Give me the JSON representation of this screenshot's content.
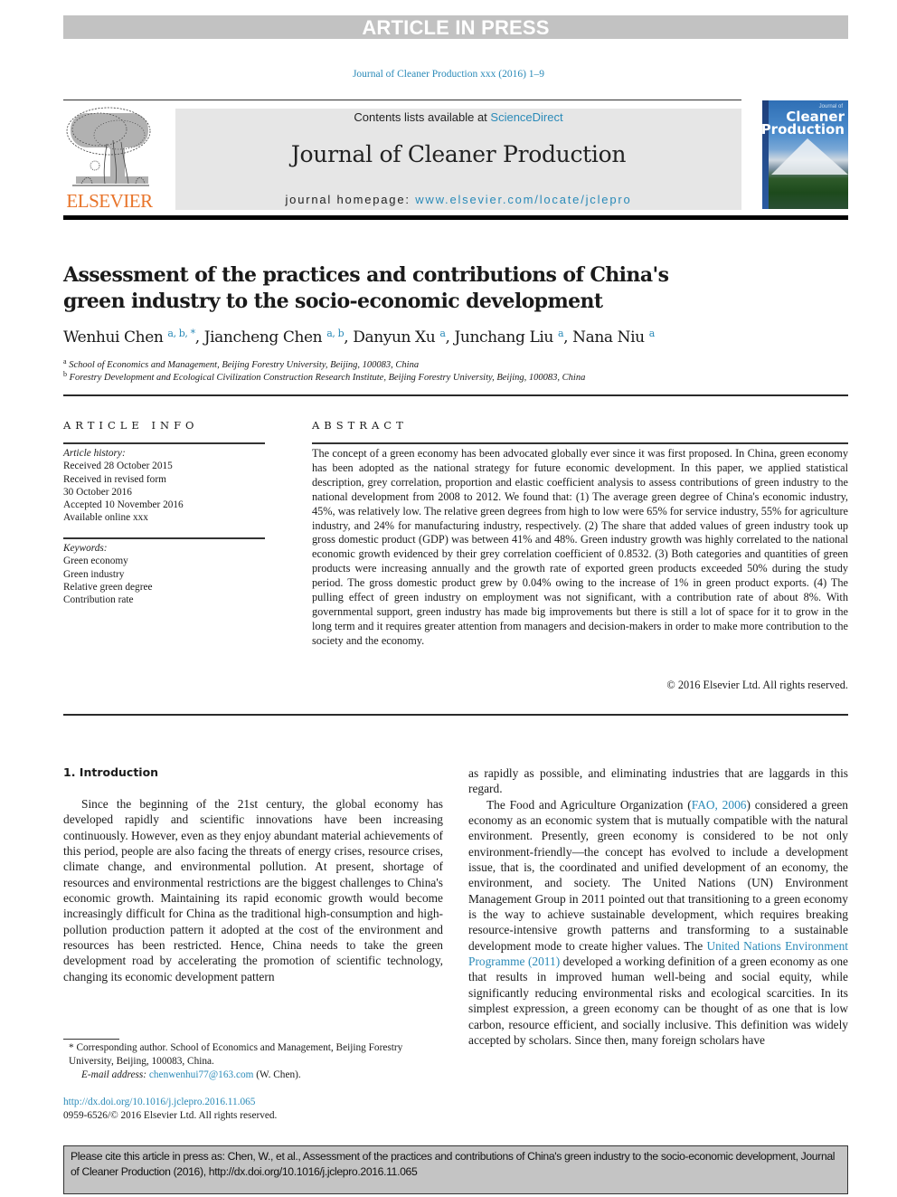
{
  "banner": {
    "label": "ARTICLE IN PRESS"
  },
  "journal_ref": "Journal of Cleaner Production xxx (2016) 1–9",
  "masthead": {
    "publisher_logo_text": "ELSEVIER",
    "contents_prefix": "Contents lists available at ",
    "contents_link": "ScienceDirect",
    "journal_title": "Journal of Cleaner Production",
    "homepage_prefix": "journal homepage: ",
    "homepage_link": "www.elsevier.com/locate/jclepro",
    "cover": {
      "small_title": "Journal of",
      "title_line1": "Cleaner",
      "title_line2": "Production"
    }
  },
  "article": {
    "title": "Assessment of the practices and contributions of China's green industry to the socio-economic development",
    "authors": [
      {
        "name": "Wenhui Chen",
        "affil": "a, b, *",
        "sep": ", "
      },
      {
        "name": "Jiancheng Chen",
        "affil": "a, b",
        "sep": ", "
      },
      {
        "name": "Danyun Xu",
        "affil": "a",
        "sep": ", "
      },
      {
        "name": "Junchang Liu",
        "affil": "a",
        "sep": ", "
      },
      {
        "name": "Nana Niu",
        "affil": "a",
        "sep": ""
      }
    ],
    "affiliations": [
      {
        "key": "a",
        "text": "School of Economics and Management, Beijing Forestry University, Beijing, 100083, China"
      },
      {
        "key": "b",
        "text": "Forestry Development and Ecological Civilization Construction Research Institute, Beijing Forestry University, Beijing, 100083, China"
      }
    ]
  },
  "article_info": {
    "heading": "ARTICLE INFO",
    "history_label": "Article history:",
    "history": [
      "Received 28 October 2015",
      "Received in revised form",
      "30 October 2016",
      "Accepted 10 November 2016",
      "Available online xxx"
    ],
    "keywords_label": "Keywords:",
    "keywords": [
      "Green economy",
      "Green industry",
      "Relative green degree",
      "Contribution rate"
    ]
  },
  "abstract": {
    "heading": "ABSTRACT",
    "text": "The concept of a green economy has been advocated globally ever since it was first proposed. In China, green economy has been adopted as the national strategy for future economic development. In this paper, we applied statistical description, grey correlation, proportion and elastic coefficient analysis to assess contributions of green industry to the national development from 2008 to 2012. We found that: (1) The average green degree of China's economic industry, 45%, was relatively low. The relative green degrees from high to low were 65% for service industry, 55% for agriculture industry, and 24% for manufacturing industry, respectively. (2) The share that added values of green industry took up gross domestic product (GDP) was between 41% and 48%. Green industry growth was highly correlated to the national economic growth evidenced by their grey correlation coefficient of 0.8532. (3) Both categories and quantities of green products were increasing annually and the growth rate of exported green products exceeded 50% during the study period. The gross domestic product grew by 0.04% owing to the increase of 1% in green product exports. (4) The pulling effect of green industry on employment was not significant, with a contribution rate of about 8%. With governmental support, green industry has made big improvements but there is still a lot of space for it to grow in the long term and it requires greater attention from managers and decision-makers in order to make more contribution to the society and the economy.",
    "copyright": "© 2016 Elsevier Ltd. All rights reserved."
  },
  "body": {
    "section_heading": "1.  Introduction",
    "left_paragraph": "Since the beginning of the 21st century, the global economy has developed rapidly and scientific innovations have been increasing continuously. However, even as they enjoy abundant material achievements of this period, people are also facing the threats of energy crises, resource crises, climate change, and environmental pollution. At present, shortage of resources and environmental restrictions are the biggest challenges to China's economic growth. Maintaining its rapid economic growth would become increasingly difficult for China as the traditional high-consumption and high-pollution production pattern it adopted at the cost of the environment and resources has been restricted. Hence, China needs to take the green development road by accelerating the promotion of scientific technology, changing its economic development pattern",
    "right_continuation": "as rapidly as possible, and eliminating industries that are laggards in this regard.",
    "right_p2_a": "The Food and Agriculture Organization (",
    "right_p2_link1": "FAO, 2006",
    "right_p2_b": ") considered a green economy as an economic system that is mutually compatible with the natural environment. Presently, green economy is considered to be not only environment-friendly—the concept has evolved to include a development issue, that is, the coordinated and unified development of an economy, the environment, and society. The United Nations (UN) Environment Management Group in 2011 pointed out that transitioning to a green economy is the way to achieve sustainable development, which requires breaking resource-intensive growth patterns and transforming to a sustainable development mode to create higher values. The ",
    "right_p2_link2": "United Nations Environment Programme (2011)",
    "right_p2_c": " developed a working definition of a green economy as one that results in improved human well-being and social equity, while significantly reducing environmental risks and ecological scarcities. In its simplest expression, a green economy can be thought of as one that is low carbon, resource efficient, and socially inclusive. This definition was widely accepted by scholars. Since then, many foreign scholars have"
  },
  "footnote": {
    "star": "*",
    "corresponding": "Corresponding author. School of Economics and Management, Beijing Forestry University, Beijing, 100083, China.",
    "email_label": "E-mail address: ",
    "email": "chenwenhui77@163.com",
    "email_suffix": " (W. Chen).",
    "doi": "http://dx.doi.org/10.1016/j.jclepro.2016.11.065",
    "issn_line": "0959-6526/© 2016 Elsevier Ltd. All rights reserved."
  },
  "cite_box": {
    "text": "Please cite this article in press as: Chen, W., et al., Assessment of the practices and contributions of China's green industry to the socio-economic development, Journal of Cleaner Production (2016), http://dx.doi.org/10.1016/j.jclepro.2016.11.065"
  },
  "colors": {
    "link": "#2a8ab8",
    "elsevier_orange": "#e8742a",
    "banner_gray": "#c2c2c2",
    "masthead_gray": "#e6e6e6"
  }
}
